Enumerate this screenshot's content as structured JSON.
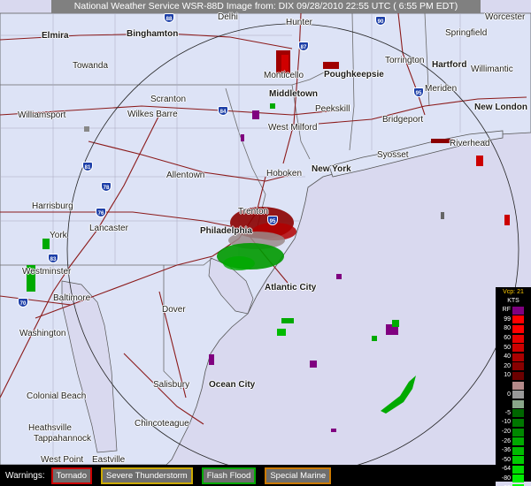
{
  "title": "National Weather Service WSR-88D Image from: DIX 09/28/2010 22:55 UTC ( 6:55 PM EDT)",
  "colors": {
    "land": "#dde3f6",
    "water": "#d9d9ef",
    "tornado": "#cc0000",
    "severe_thunderstorm": "#ccaa00",
    "flash_flood": "#00aa00",
    "special_marine": "#cc7a00"
  },
  "cities": [
    {
      "name": "Delhi"
    },
    {
      "name": "Hunter"
    },
    {
      "name": "Worcester"
    },
    {
      "name": "Elmira"
    },
    {
      "name": "Binghamton"
    },
    {
      "name": "Springfield"
    },
    {
      "name": "Torrington"
    },
    {
      "name": "Hartford"
    },
    {
      "name": "Willimantic"
    },
    {
      "name": "Towanda"
    },
    {
      "name": "Monticello"
    },
    {
      "name": "Poughkeepsie"
    },
    {
      "name": "Meriden"
    },
    {
      "name": "Middletown"
    },
    {
      "name": "Scranton"
    },
    {
      "name": "New London"
    },
    {
      "name": "Williamsport"
    },
    {
      "name": "Wilkes Barre"
    },
    {
      "name": "Peekskill"
    },
    {
      "name": "Bridgeport"
    },
    {
      "name": "West Milford"
    },
    {
      "name": "Riverhead"
    },
    {
      "name": "Syosset"
    },
    {
      "name": "New York"
    },
    {
      "name": "Allentown"
    },
    {
      "name": "Hoboken"
    },
    {
      "name": "Harrisburg"
    },
    {
      "name": "Trenton"
    },
    {
      "name": "Lancaster"
    },
    {
      "name": "Philadelphia"
    },
    {
      "name": "York"
    },
    {
      "name": "Westminster"
    },
    {
      "name": "Atlantic City"
    },
    {
      "name": "Baltimore"
    },
    {
      "name": "Dover"
    },
    {
      "name": "Washington"
    },
    {
      "name": "Salisbury"
    },
    {
      "name": "Ocean City"
    },
    {
      "name": "Colonial Beach"
    },
    {
      "name": "Chincoteague"
    },
    {
      "name": "Heathsville"
    },
    {
      "name": "Tappahannock"
    },
    {
      "name": "West Point"
    },
    {
      "name": "Eastville"
    }
  ],
  "highways": [
    "88",
    "87",
    "90",
    "84",
    "81",
    "78",
    "76",
    "83",
    "95",
    "70",
    "95"
  ],
  "legend": {
    "vcp": "Vcp: 21",
    "units": "KTS",
    "items": [
      {
        "label": "RF",
        "color": "#800080"
      },
      {
        "label": "99",
        "color": "#ff0000"
      },
      {
        "label": "80",
        "color": "#ff0000"
      },
      {
        "label": "60",
        "color": "#e60000"
      },
      {
        "label": "50",
        "color": "#cc0000"
      },
      {
        "label": "40",
        "color": "#aa0000"
      },
      {
        "label": "20",
        "color": "#880000"
      },
      {
        "label": "10",
        "color": "#6b0000"
      },
      {
        "label": "",
        "color": "#b48a8a"
      },
      {
        "label": "0",
        "color": "#999999"
      },
      {
        "label": "",
        "color": "#8aa68a"
      },
      {
        "label": "-5",
        "color": "#006600"
      },
      {
        "label": "-10",
        "color": "#007700"
      },
      {
        "label": "-20",
        "color": "#008800"
      },
      {
        "label": "-26",
        "color": "#00aa00"
      },
      {
        "label": "-36",
        "color": "#00bb00"
      },
      {
        "label": "-50",
        "color": "#00cc00"
      },
      {
        "label": "-64",
        "color": "#00dd00"
      },
      {
        "label": "-80",
        "color": "#00ee00"
      },
      {
        "label": "-99",
        "color": "#00ff00"
      },
      {
        "label": "ND",
        "color": "#000000"
      }
    ]
  },
  "warnings": {
    "label": "Warnings:",
    "items": [
      "Tornado",
      "Severe Thunderstorm",
      "Flash Flood",
      "Special Marine"
    ]
  }
}
